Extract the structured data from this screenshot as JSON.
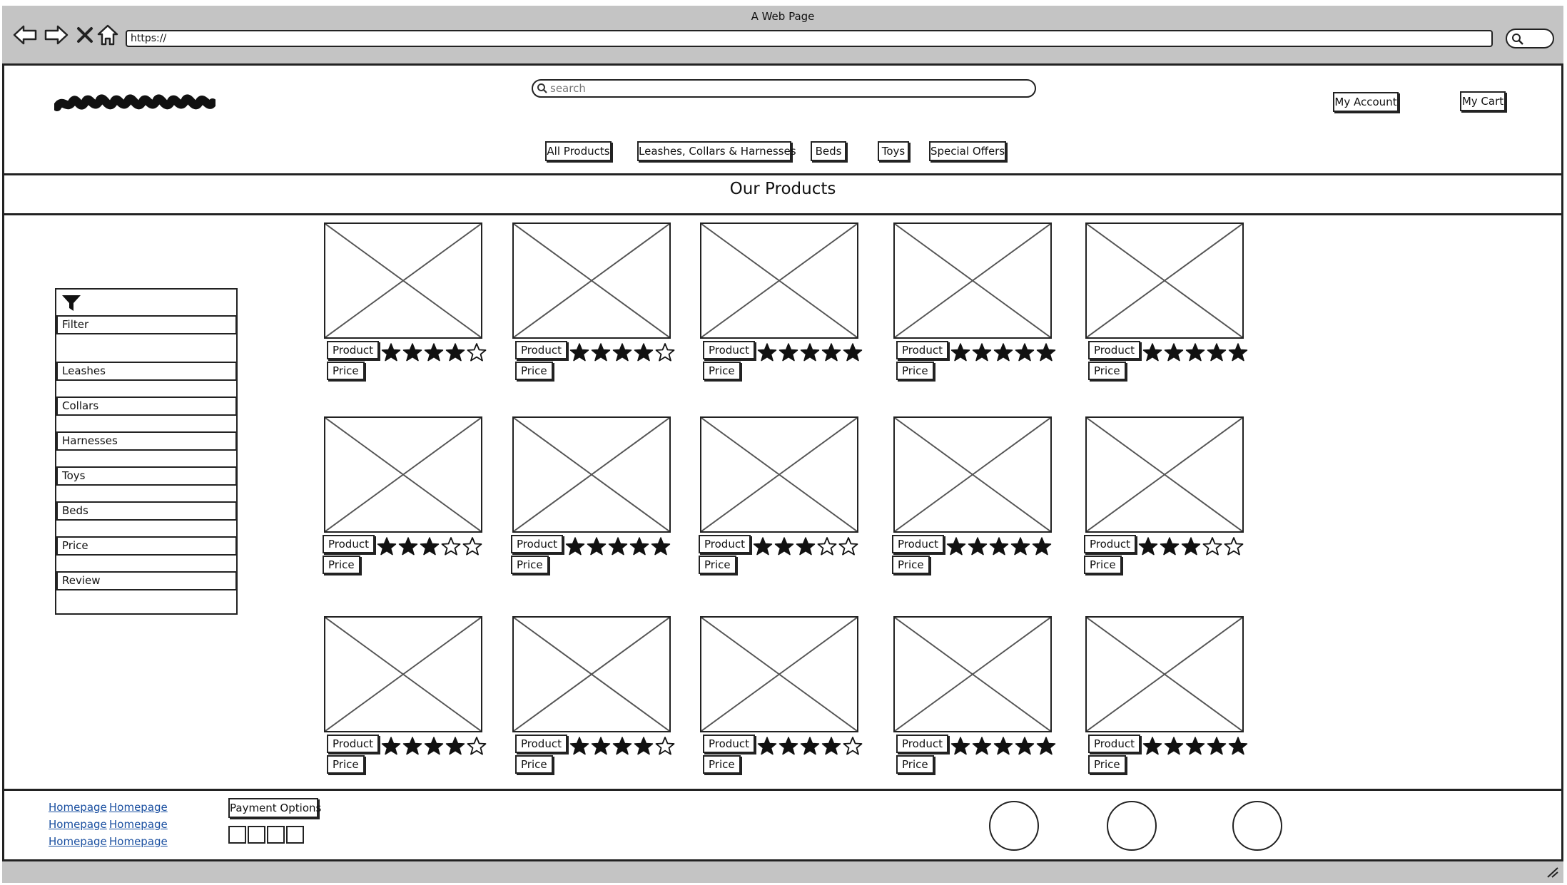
{
  "window": {
    "title": "A Web Page",
    "url": "https://"
  },
  "header": {
    "search_placeholder": "search",
    "my_account": "My Account",
    "my_cart": "My Cart"
  },
  "nav": {
    "items": [
      "All Products",
      "Leashes, Collars & Harnesses",
      "Beds",
      "Toys",
      "Special Offers"
    ]
  },
  "page_title": "Our Products",
  "filter": {
    "label": "Filter",
    "items": [
      "Leashes",
      "Collars",
      "Harnesses",
      "Toys",
      "Beds",
      "Price",
      "Review"
    ]
  },
  "product_labels": {
    "name": "Product",
    "price": "Price"
  },
  "products": [
    {
      "rating": 4
    },
    {
      "rating": 4
    },
    {
      "rating": 5
    },
    {
      "rating": 5
    },
    {
      "rating": 5
    },
    {
      "rating": 3
    },
    {
      "rating": 5
    },
    {
      "rating": 3
    },
    {
      "rating": 5
    },
    {
      "rating": 3
    },
    {
      "rating": 4
    },
    {
      "rating": 4
    },
    {
      "rating": 4
    },
    {
      "rating": 5
    },
    {
      "rating": 5
    }
  ],
  "footer": {
    "links": [
      "Homepage",
      "Homepage",
      "Homepage",
      "Homepage",
      "Homepage",
      "Homepage"
    ],
    "payment_label": "Payment Options"
  }
}
